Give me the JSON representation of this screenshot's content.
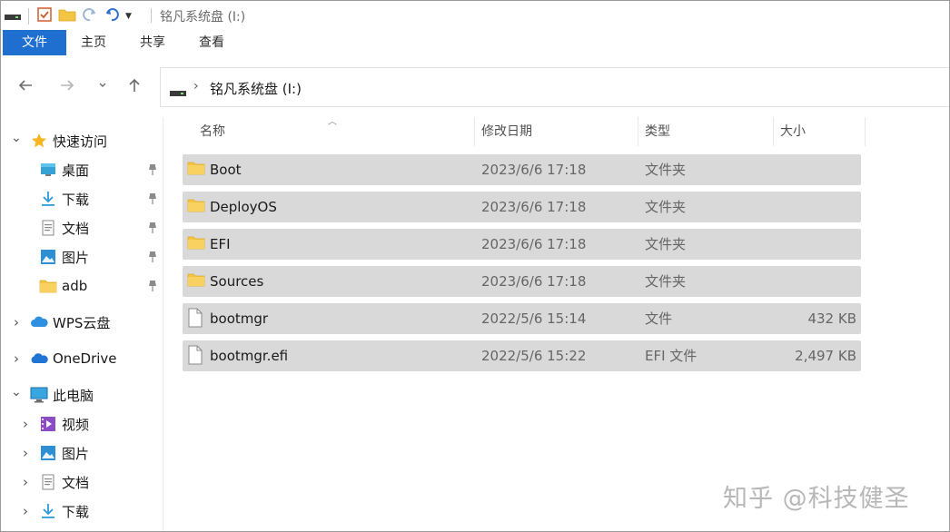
{
  "window": {
    "title": "铭凡系统盘 (I:)"
  },
  "ribbon": {
    "tabs": [
      "文件",
      "主页",
      "共享",
      "查看"
    ]
  },
  "address": {
    "path": "铭凡系统盘 (I:)"
  },
  "sidebar": {
    "items": [
      {
        "label": "快速访问",
        "icon": "star-icon",
        "expand": "expanded",
        "level": 0,
        "pinned": false
      },
      {
        "label": "桌面",
        "icon": "desktop-icon",
        "expand": "none",
        "level": 1,
        "pinned": true
      },
      {
        "label": "下载",
        "icon": "download-icon",
        "expand": "none",
        "level": 1,
        "pinned": true
      },
      {
        "label": "文档",
        "icon": "document-icon",
        "expand": "none",
        "level": 1,
        "pinned": true
      },
      {
        "label": "图片",
        "icon": "picture-icon",
        "expand": "none",
        "level": 1,
        "pinned": true
      },
      {
        "label": "adb",
        "icon": "folder-icon",
        "expand": "none",
        "level": 1,
        "pinned": true
      },
      {
        "label": "WPS云盘",
        "icon": "cloud-icon",
        "expand": "collapsed",
        "level": 0,
        "pinned": false
      },
      {
        "label": "OneDrive",
        "icon": "onedrive-icon",
        "expand": "collapsed",
        "level": 0,
        "pinned": false
      },
      {
        "label": "此电脑",
        "icon": "computer-icon",
        "expand": "expanded",
        "level": 0,
        "pinned": false
      },
      {
        "label": "视频",
        "icon": "video-icon",
        "expand": "collapsed",
        "level": 1,
        "pinned": false
      },
      {
        "label": "图片",
        "icon": "picture-icon",
        "expand": "collapsed",
        "level": 1,
        "pinned": false
      },
      {
        "label": "文档",
        "icon": "document-icon",
        "expand": "collapsed",
        "level": 1,
        "pinned": false
      },
      {
        "label": "下载",
        "icon": "download-icon",
        "expand": "collapsed",
        "level": 1,
        "pinned": false
      }
    ]
  },
  "file_list": {
    "columns": [
      "名称",
      "修改日期",
      "类型",
      "大小"
    ],
    "rows": [
      {
        "name": "Boot",
        "date": "2023/6/6 17:18",
        "type": "文件夹",
        "size": "",
        "icon": "folder-icon"
      },
      {
        "name": "DeployOS",
        "date": "2023/6/6 17:18",
        "type": "文件夹",
        "size": "",
        "icon": "folder-icon"
      },
      {
        "name": "EFI",
        "date": "2023/6/6 17:18",
        "type": "文件夹",
        "size": "",
        "icon": "folder-icon"
      },
      {
        "name": "Sources",
        "date": "2023/6/6 17:18",
        "type": "文件夹",
        "size": "",
        "icon": "folder-icon"
      },
      {
        "name": "bootmgr",
        "date": "2022/5/6 15:14",
        "type": "文件",
        "size": "432 KB",
        "icon": "file-icon"
      },
      {
        "name": "bootmgr.efi",
        "date": "2022/5/6 15:22",
        "type": "EFI 文件",
        "size": "2,497 KB",
        "icon": "file-icon"
      }
    ]
  },
  "watermark": "知乎 @科技健圣",
  "colors": {
    "accent": "#1f6fd1",
    "selection": "#d9d9d9",
    "folder": "#f4c542"
  }
}
